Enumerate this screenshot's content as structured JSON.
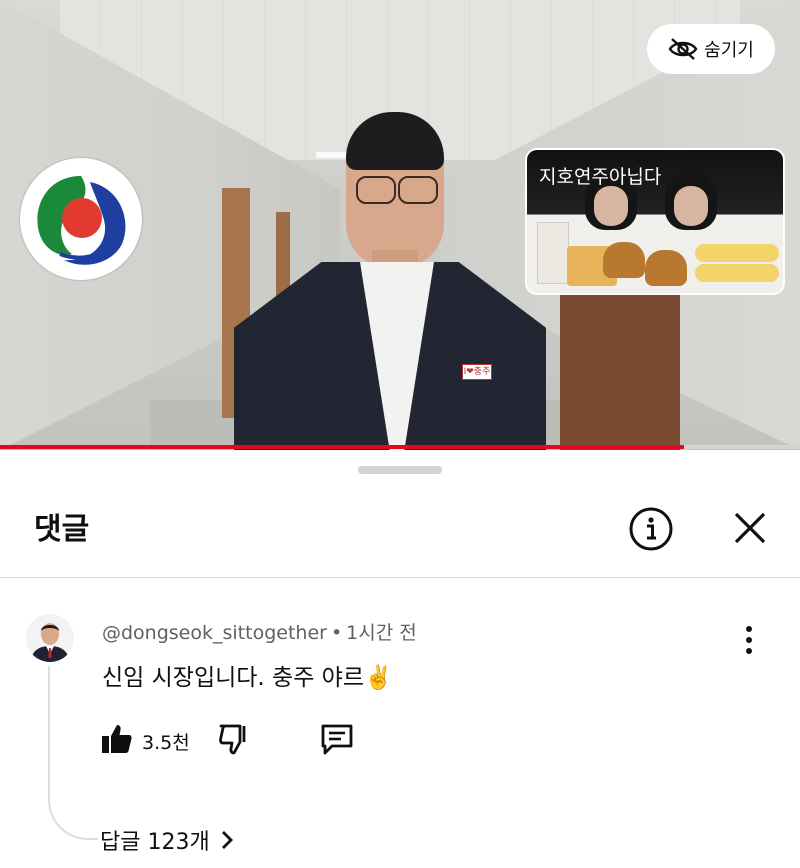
{
  "video": {
    "hide_button_label": "숨기기",
    "pip_title": "지호연주아닙다",
    "pin_text": "I❤충주",
    "progress_fraction": 0.855
  },
  "comments": {
    "title": "댓글",
    "comment": {
      "author": "@dongseok_sittogether",
      "time": "1시간 전",
      "text": "신임 시장입니다. 충주 야르✌️",
      "likes": "3.5천",
      "replies_label": "답글 123개"
    }
  },
  "colors": {
    "accent": "#e2081f",
    "text": "#0f0f0f",
    "secondary_text": "#606060"
  },
  "icons": {
    "hide": "eye-off-icon",
    "info": "info-icon",
    "close": "close-icon",
    "more": "vertical-dots-icon",
    "like": "thumbs-up-icon",
    "dislike": "thumbs-down-icon",
    "reply": "comment-icon",
    "chevron": "chevron-right-icon"
  }
}
